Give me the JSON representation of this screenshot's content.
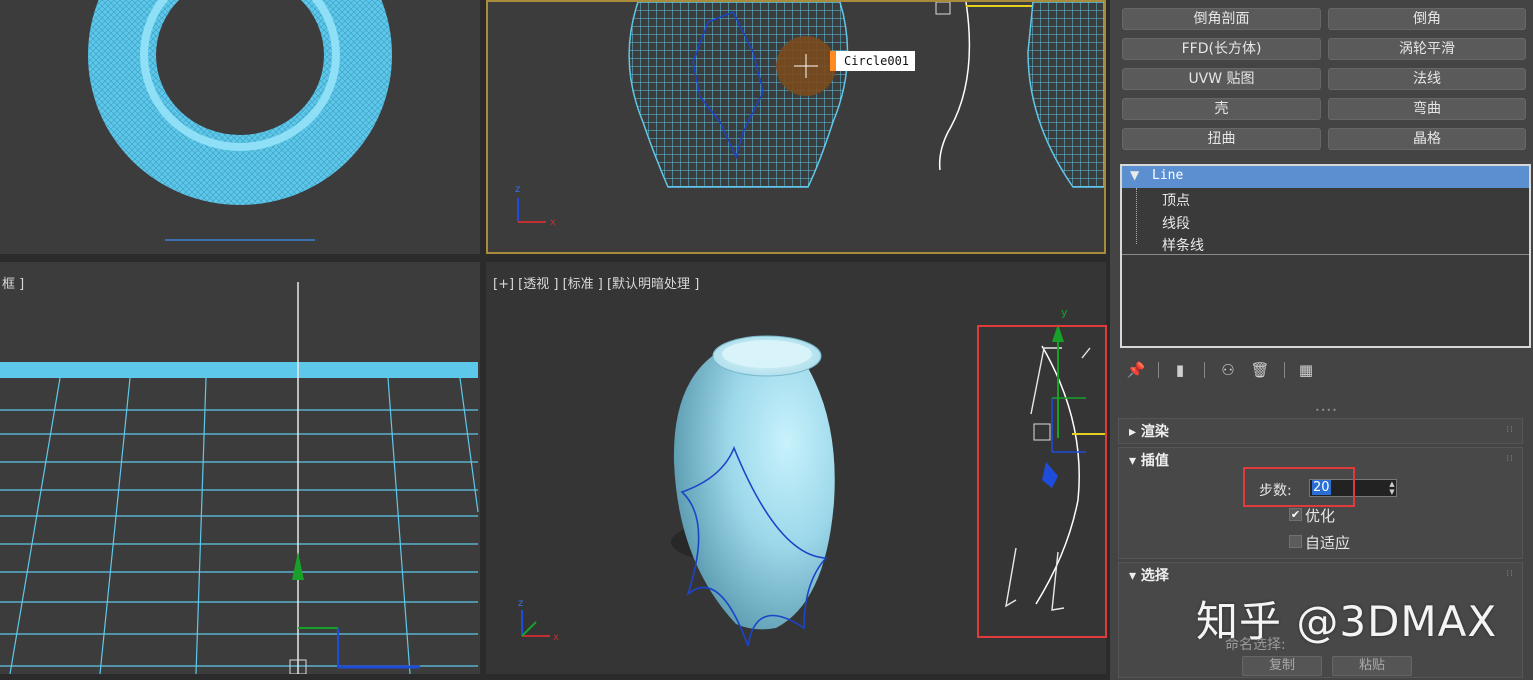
{
  "viewports": {
    "top_left": {
      "label": ""
    },
    "top_right": {
      "label": ""
    },
    "bottom_left": {
      "label": "框 ]"
    },
    "bottom_right": {
      "label": "[+] [透视 ] [标准 ] [默认明暗处理 ]"
    }
  },
  "selected_object_tag": "Circle001",
  "axis_labels": {
    "x": "x",
    "y": "y",
    "z": "z"
  },
  "modifier_buttons": [
    {
      "label": "倒角剖面"
    },
    {
      "label": "倒角"
    },
    {
      "label": "FFD(长方体)"
    },
    {
      "label": "涡轮平滑"
    },
    {
      "label": "UVW 贴图"
    },
    {
      "label": "法线"
    },
    {
      "label": "壳"
    },
    {
      "label": "弯曲"
    },
    {
      "label": "扭曲"
    },
    {
      "label": "晶格"
    }
  ],
  "modifier_stack": {
    "item": "Line",
    "subobjects": [
      "顶点",
      "线段",
      "样条线"
    ]
  },
  "toolbar_icons": [
    "pin-icon",
    "show-end-result-icon",
    "make-unique-icon",
    "remove-modifier-icon",
    "configure-modifier-sets-icon"
  ],
  "rollouts": {
    "render": {
      "title": "渲染"
    },
    "interpolation": {
      "title": "插值",
      "steps_label": "步数:",
      "steps_value": "20",
      "optimize_label": "优化",
      "optimize_checked": true,
      "adaptive_label": "自适应",
      "adaptive_checked": false
    },
    "selection": {
      "title": "选择",
      "named_selection_label": "命名选择:",
      "copy_label": "复制",
      "paste_label": "粘贴"
    }
  },
  "watermark": "知乎 @3DMAX",
  "colors": {
    "mesh": "#5ec8ea",
    "wire_blue": "#1a45c8",
    "highlight_red": "#e03a3a",
    "active_border": "#a88c3c",
    "stack_selected": "#5b8fd0"
  }
}
